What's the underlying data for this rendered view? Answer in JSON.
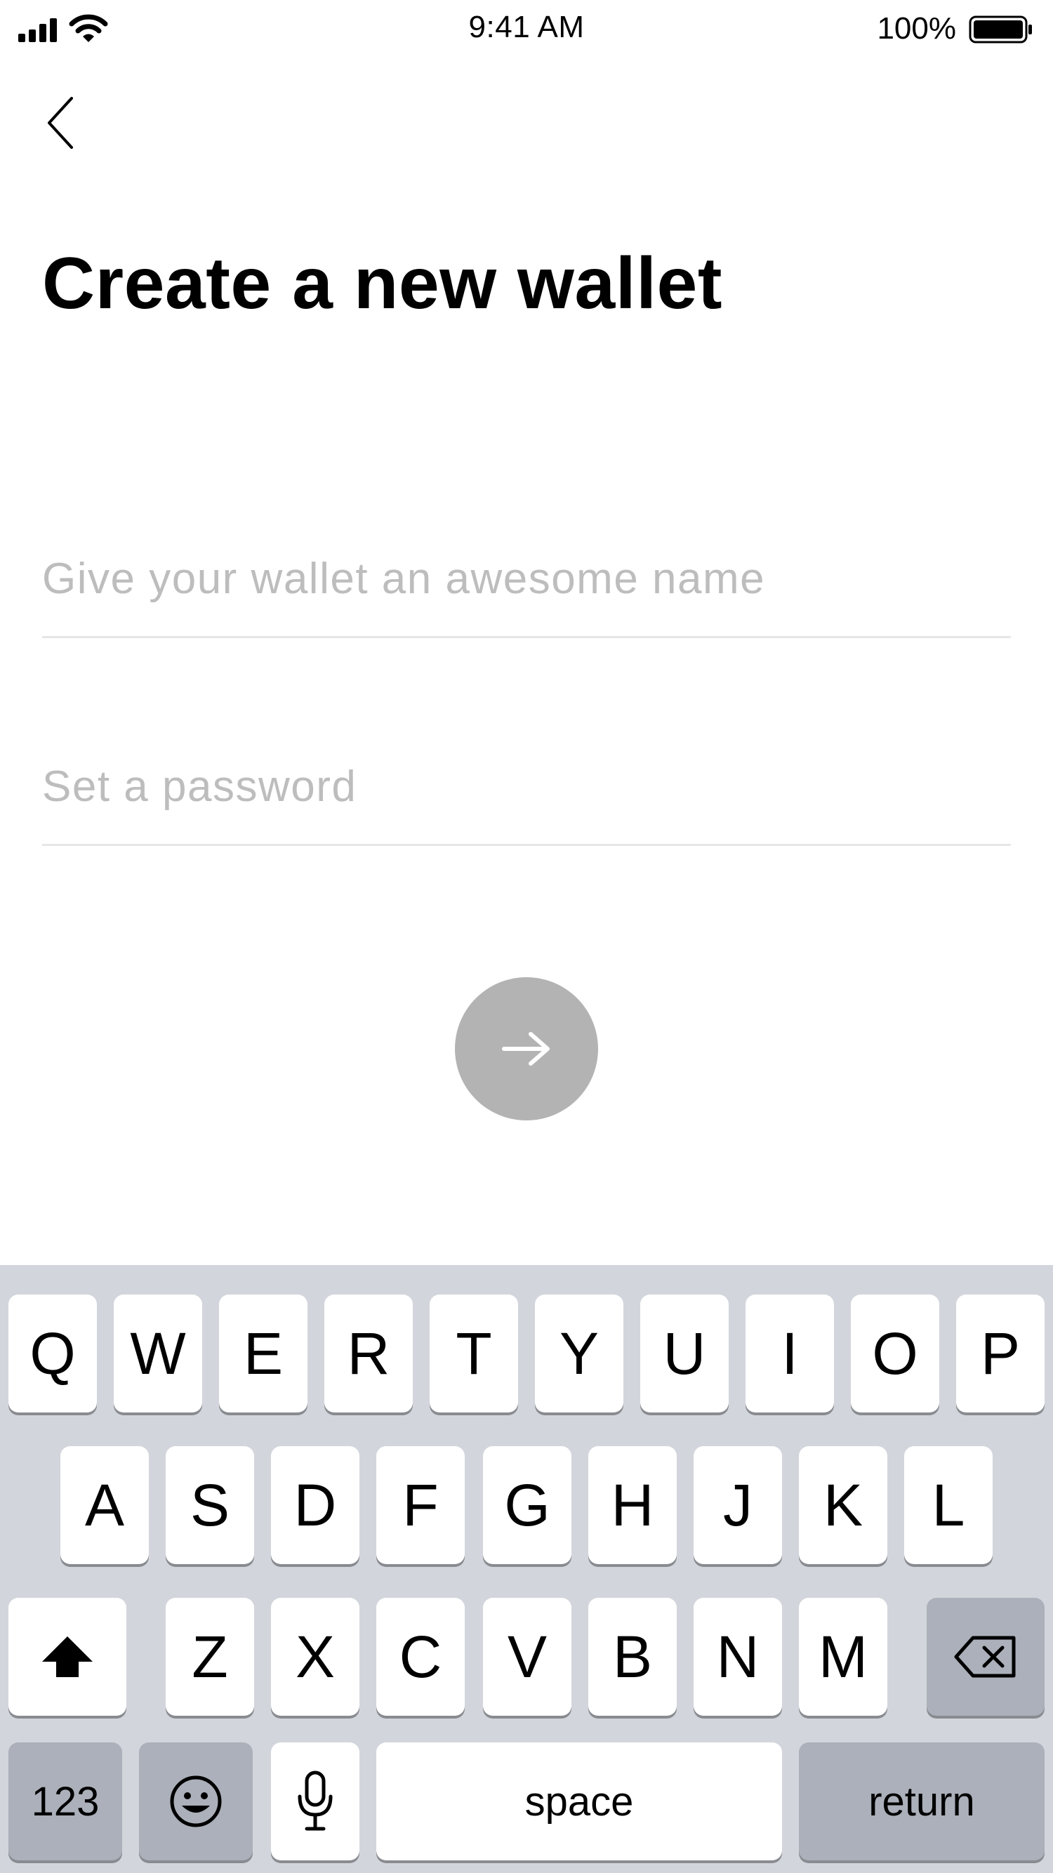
{
  "status_bar": {
    "time": "9:41 AM",
    "battery_percent": "100%"
  },
  "header": {
    "title": "Create a new wallet"
  },
  "form": {
    "wallet_name_placeholder": "Give your wallet an awesome name",
    "wallet_name_value": "",
    "password_placeholder": "Set a password",
    "password_value": ""
  },
  "next_button": {
    "icon": "arrow-right-icon",
    "color": "#b3b3b3"
  },
  "keyboard": {
    "row1": [
      "Q",
      "W",
      "E",
      "R",
      "T",
      "Y",
      "U",
      "I",
      "O",
      "P"
    ],
    "row2": [
      "A",
      "S",
      "D",
      "F",
      "G",
      "H",
      "J",
      "K",
      "L"
    ],
    "row3": [
      "Z",
      "X",
      "C",
      "V",
      "B",
      "N",
      "M"
    ],
    "shift_icon": "shift-icon",
    "delete_icon": "delete-icon",
    "numbers_label": "123",
    "emoji_icon": "emoji-icon",
    "mic_icon": "microphone-icon",
    "space_label": "space",
    "return_label": "return"
  }
}
